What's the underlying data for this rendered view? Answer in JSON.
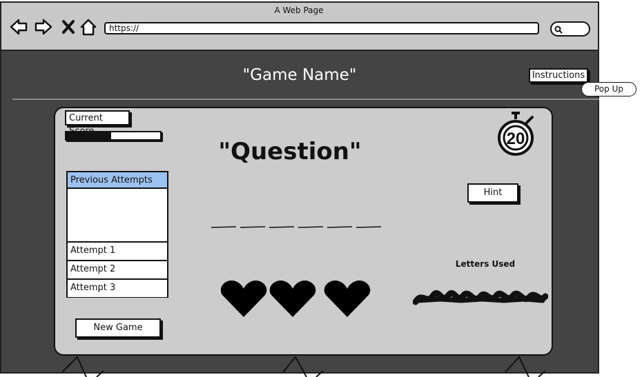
{
  "browser": {
    "window_title": "A Web Page",
    "url": "https://",
    "nav_icons": [
      "back-arrow-icon",
      "forward-arrow-icon",
      "close-x-icon",
      "home-icon"
    ],
    "search_icon": "search-icon"
  },
  "header": {
    "game_title": "\"Game Name\"",
    "instructions_label": "Instructions",
    "popup_label": "Pop Up"
  },
  "game": {
    "score_label": "Current Score",
    "score_progress": 0.48,
    "question": "\"Question\"",
    "timer_value": "20",
    "attempts": {
      "header": "Previous Attempts",
      "items": [
        "Attempt 1",
        "Attempt 2",
        "Attempt 3"
      ]
    },
    "hint_label": "Hint",
    "letters_used_label": "Letters Used",
    "blank_count": 6,
    "lives": 3,
    "new_game_label": "New Game"
  },
  "colors": {
    "page_background": "#444444",
    "panel_background": "#cccccc",
    "list_header_highlight": "#9cc3f0"
  }
}
